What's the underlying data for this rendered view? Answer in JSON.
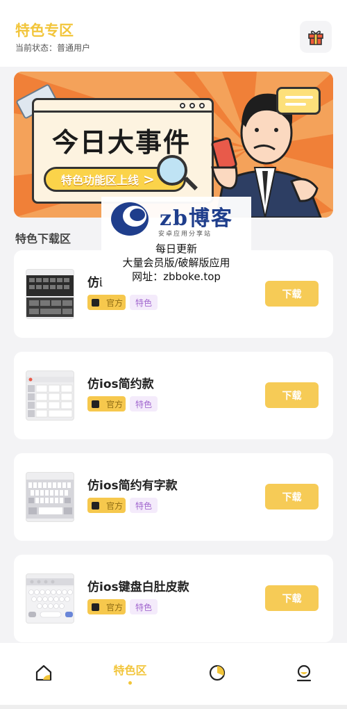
{
  "header": {
    "title": "特色专区",
    "status": "当前状态：普通用户"
  },
  "banner": {
    "headline": "今日大事件",
    "pill_label": "特色功能区上线",
    "pill_arrow": ">"
  },
  "watermark": {
    "brand": "zb博客",
    "tagline": "安卓应用分享站",
    "line1": "每日更新",
    "line2": "大量会员版/破解版应用",
    "line3": "网址：zbboke.top"
  },
  "section": {
    "title": "特色下载区"
  },
  "items": [
    {
      "name": "仿i",
      "tag_official": "官方",
      "tag_special": "特色",
      "button": "下载",
      "thumb_theme": "dark"
    },
    {
      "name": "仿ios简约款",
      "tag_official": "官方",
      "tag_special": "特色",
      "button": "下载",
      "thumb_theme": "light"
    },
    {
      "name": "仿ios简约有字款",
      "tag_official": "官方",
      "tag_special": "特色",
      "button": "下载",
      "thumb_theme": "light"
    },
    {
      "name": "仿ios键盘白肚皮款",
      "tag_official": "官方",
      "tag_special": "特色",
      "button": "下载",
      "thumb_theme": "white"
    }
  ],
  "tabbar": {
    "tabs": [
      {
        "icon": "home-icon",
        "label": ""
      },
      {
        "icon": "special-icon",
        "label": "特色区",
        "active": true
      },
      {
        "icon": "pie-chart-icon",
        "label": ""
      },
      {
        "icon": "profile-icon",
        "label": ""
      }
    ]
  },
  "colors": {
    "accent": "#f2c53a",
    "button": "#f6cb56",
    "tag_special_bg": "#f4ebfb",
    "tag_special_text": "#a369cf",
    "banner_orange": "#f1732b"
  }
}
